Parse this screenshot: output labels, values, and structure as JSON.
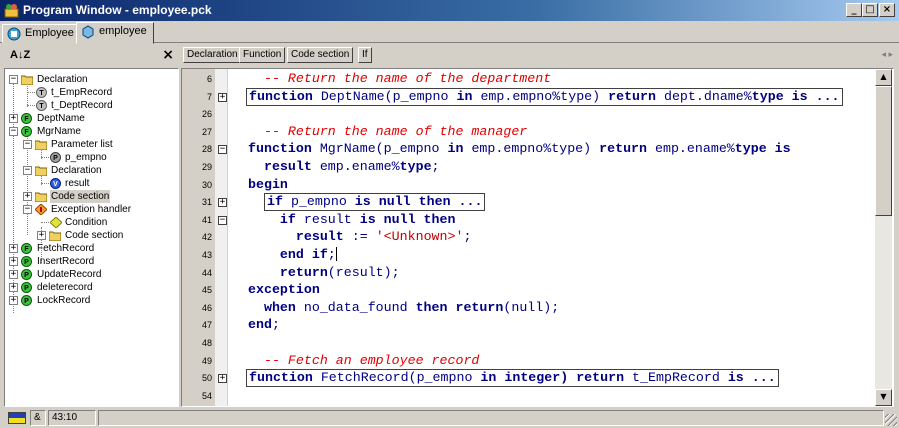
{
  "window": {
    "title": "Program Window - employee.pck"
  },
  "tabs": [
    {
      "label": "Employee",
      "icon": "package-spec-icon"
    },
    {
      "label": "employee",
      "icon": "package-body-icon"
    }
  ],
  "left_toolbar": {
    "sort_icon": "sort-az-icon",
    "sort_glyph": "A↓Z"
  },
  "tree": [
    {
      "label": "Declaration",
      "icon": "folder-icon"
    },
    {
      "label": "t_EmpRecord",
      "icon": "type-icon"
    },
    {
      "label": "t_DeptRecord",
      "icon": "type-icon"
    },
    {
      "label": "DeptName",
      "icon": "function-icon"
    },
    {
      "label": "MgrName",
      "icon": "function-icon"
    },
    {
      "label": "Parameter list",
      "icon": "folder-icon"
    },
    {
      "label": "p_empno",
      "icon": "parameter-icon"
    },
    {
      "label": "Declaration",
      "icon": "folder-icon"
    },
    {
      "label": "result",
      "icon": "variable-icon"
    },
    {
      "label": "Code section",
      "icon": "folder-icon"
    },
    {
      "label": "Exception handler",
      "icon": "exception-icon"
    },
    {
      "label": "Condition",
      "icon": "condition-icon"
    },
    {
      "label": "Code section",
      "icon": "folder-icon"
    },
    {
      "label": "FetchRecord",
      "icon": "function-icon"
    },
    {
      "label": "InsertRecord",
      "icon": "procedure-icon"
    },
    {
      "label": "UpdateRecord",
      "icon": "procedure-icon"
    },
    {
      "label": "deleterecord",
      "icon": "procedure-icon"
    },
    {
      "label": "LockRecord",
      "icon": "procedure-icon"
    }
  ],
  "code_toolbar": [
    "Declaration",
    "Function",
    "Code section",
    "If"
  ],
  "code": {
    "line_numbers": [
      "6",
      "7",
      "26",
      "27",
      "28",
      "29",
      "30",
      "31",
      "41",
      "42",
      "43",
      "44",
      "45",
      "46",
      "47",
      "48",
      "49",
      "50",
      "54"
    ],
    "lines": [
      [
        {
          "t": "  -- Return the name of the department",
          "c": "cm"
        }
      ],
      [
        {
          "t": "function ",
          "c": "kw"
        },
        {
          "t": "DeptName(p_empno ",
          "c": "nm"
        },
        {
          "t": "in ",
          "c": "kw"
        },
        {
          "t": "emp.empno%type) ",
          "c": "nm"
        },
        {
          "t": "return ",
          "c": "kw"
        },
        {
          "t": "dept.dname%",
          "c": "nm"
        },
        {
          "t": "type ",
          "c": "kw"
        },
        {
          "t": "is ...",
          "c": "kw"
        }
      ],
      [],
      [
        {
          "t": "  -- Return the name of the manager",
          "c": "cm"
        }
      ],
      [
        {
          "t": "function ",
          "c": "kw"
        },
        {
          "t": "MgrName(p_empno ",
          "c": "nm"
        },
        {
          "t": "in ",
          "c": "kw"
        },
        {
          "t": "emp.empno%type) ",
          "c": "nm"
        },
        {
          "t": "return ",
          "c": "kw"
        },
        {
          "t": "emp.ename%",
          "c": "nm"
        },
        {
          "t": "type is",
          "c": "kw"
        }
      ],
      [
        {
          "t": "  result ",
          "c": "kw"
        },
        {
          "t": "emp.ename%",
          "c": "nm"
        },
        {
          "t": "type",
          "c": "kw"
        },
        {
          "t": ";",
          "c": "nm"
        }
      ],
      [
        {
          "t": "begin",
          "c": "kw"
        }
      ],
      [
        {
          "t": "if ",
          "c": "kw"
        },
        {
          "t": "p_empno ",
          "c": "nm"
        },
        {
          "t": "is null then ...",
          "c": "kw"
        }
      ],
      [
        {
          "t": "    if ",
          "c": "kw"
        },
        {
          "t": "result ",
          "c": "nm"
        },
        {
          "t": "is null then",
          "c": "kw"
        }
      ],
      [
        {
          "t": "      result ",
          "c": "kw"
        },
        {
          "t": ":= ",
          "c": "nm"
        },
        {
          "t": "'<Unknown>'",
          "c": "st"
        },
        {
          "t": ";",
          "c": "nm"
        }
      ],
      [
        {
          "t": "    end if",
          "c": "kw"
        },
        {
          "t": ";",
          "c": "nm"
        }
      ],
      [
        {
          "t": "    return",
          "c": "kw"
        },
        {
          "t": "(result);",
          "c": "nm"
        }
      ],
      [
        {
          "t": "exception",
          "c": "kw"
        }
      ],
      [
        {
          "t": "  when ",
          "c": "kw"
        },
        {
          "t": "no_data_found ",
          "c": "nm"
        },
        {
          "t": "then return",
          "c": "kw"
        },
        {
          "t": "(null);",
          "c": "nm"
        }
      ],
      [
        {
          "t": "end",
          "c": "kw"
        },
        {
          "t": ";",
          "c": "nm"
        }
      ],
      [],
      [
        {
          "t": "  -- Fetch an employee record",
          "c": "cm"
        }
      ],
      [
        {
          "t": "function ",
          "c": "kw"
        },
        {
          "t": "FetchRecord(p_empno ",
          "c": "nm"
        },
        {
          "t": "in integer) ",
          "c": "kw"
        },
        {
          "t": "return ",
          "c": "kw"
        },
        {
          "t": "t_EmpRecord ",
          "c": "nm"
        },
        {
          "t": "is ...",
          "c": "kw"
        }
      ],
      []
    ]
  },
  "status": {
    "mode": "&",
    "position": "43:10"
  }
}
